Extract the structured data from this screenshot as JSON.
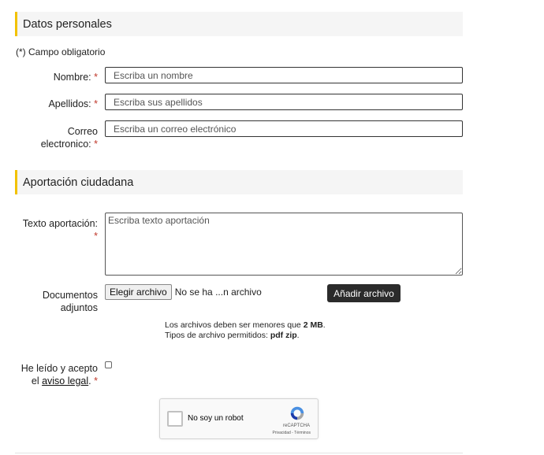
{
  "sections": {
    "personal": "Datos personales",
    "contribution": "Aportación ciudadana"
  },
  "required_note": "(*) Campo obligatorio",
  "required_mark": "*",
  "fields": {
    "nombre": {
      "label": "Nombre:",
      "placeholder": "Escriba un nombre"
    },
    "apellidos": {
      "label": "Apellidos:",
      "placeholder": "Escriba sus apellidos"
    },
    "correo": {
      "label_line1": "Correo",
      "label_line2": "electronico:",
      "placeholder": "Escriba un correo electrónico"
    },
    "texto": {
      "label": "Texto aportación:",
      "placeholder": "Escriba texto aportación"
    }
  },
  "documents": {
    "label_line1": "Documentos",
    "label_line2": "adjuntos",
    "choose_button": "Elegir archivo",
    "status": "No se ha ...n archivo",
    "add_button": "Añadir archivo",
    "hint1_prefix": "Los archivos deben ser menores que ",
    "hint1_value": "2 MB",
    "hint1_suffix": ".",
    "hint2_prefix": "Tipos de archivo permitidos: ",
    "hint2_value": "pdf zip",
    "hint2_suffix": "."
  },
  "legal": {
    "line1": "He leído y acepto",
    "line2_prefix": "el ",
    "link": "aviso legal",
    "line2_suffix": ".",
    "checked": false
  },
  "captcha": {
    "label": "No soy un robot",
    "brand": "reCAPTCHA",
    "links": "Privacidad - Términos"
  },
  "colors": {
    "accent": "#f2c200",
    "required": "#c0392b",
    "button_dark": "#2b2b2b"
  }
}
